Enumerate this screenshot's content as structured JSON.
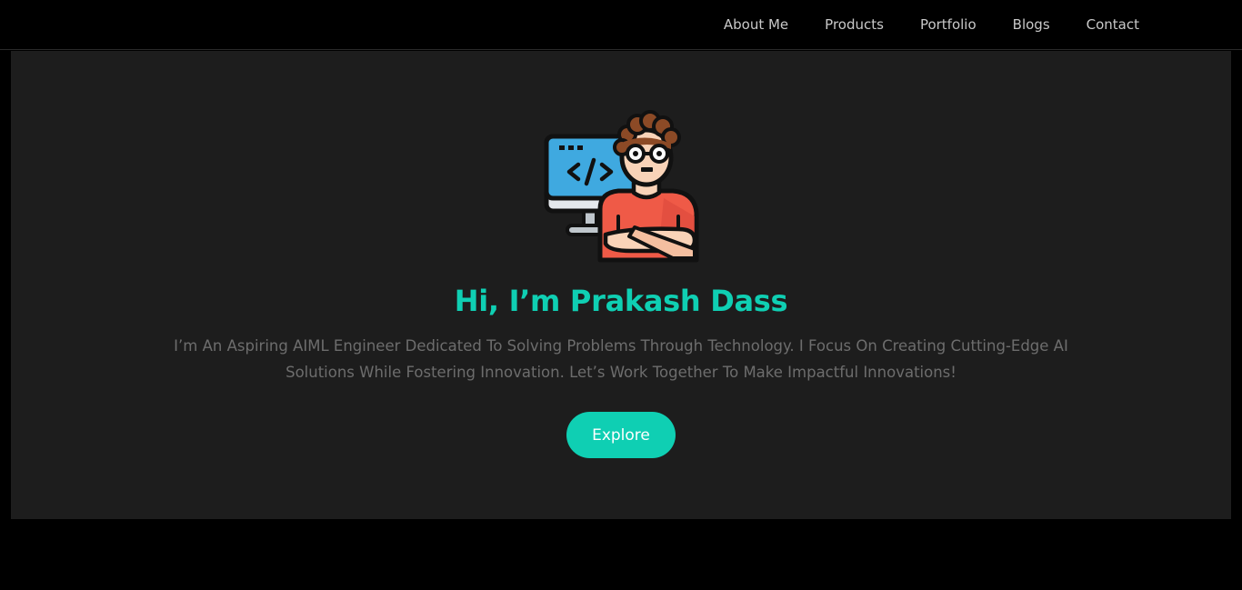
{
  "nav": {
    "items": [
      {
        "label": "About Me"
      },
      {
        "label": "Products"
      },
      {
        "label": "Portfolio"
      },
      {
        "label": "Blogs"
      },
      {
        "label": "Contact"
      }
    ]
  },
  "hero": {
    "avatar_icon": "developer-avatar-icon",
    "title": "Hi, I’m Prakash Dass",
    "description": "I’m An Aspiring AIML Engineer Dedicated To Solving Problems Through Technology. I Focus On Creating Cutting-Edge AI Solutions While Fostering Innovation. Let’s Work Together To Make Impactful Innovations!",
    "button_label": "Explore"
  },
  "colors": {
    "accent": "#0fcfb3",
    "page_background": "#000000",
    "hero_background": "#1d1d1d",
    "nav_text": "#c9c9c9",
    "description_text": "#6d6d6d"
  }
}
